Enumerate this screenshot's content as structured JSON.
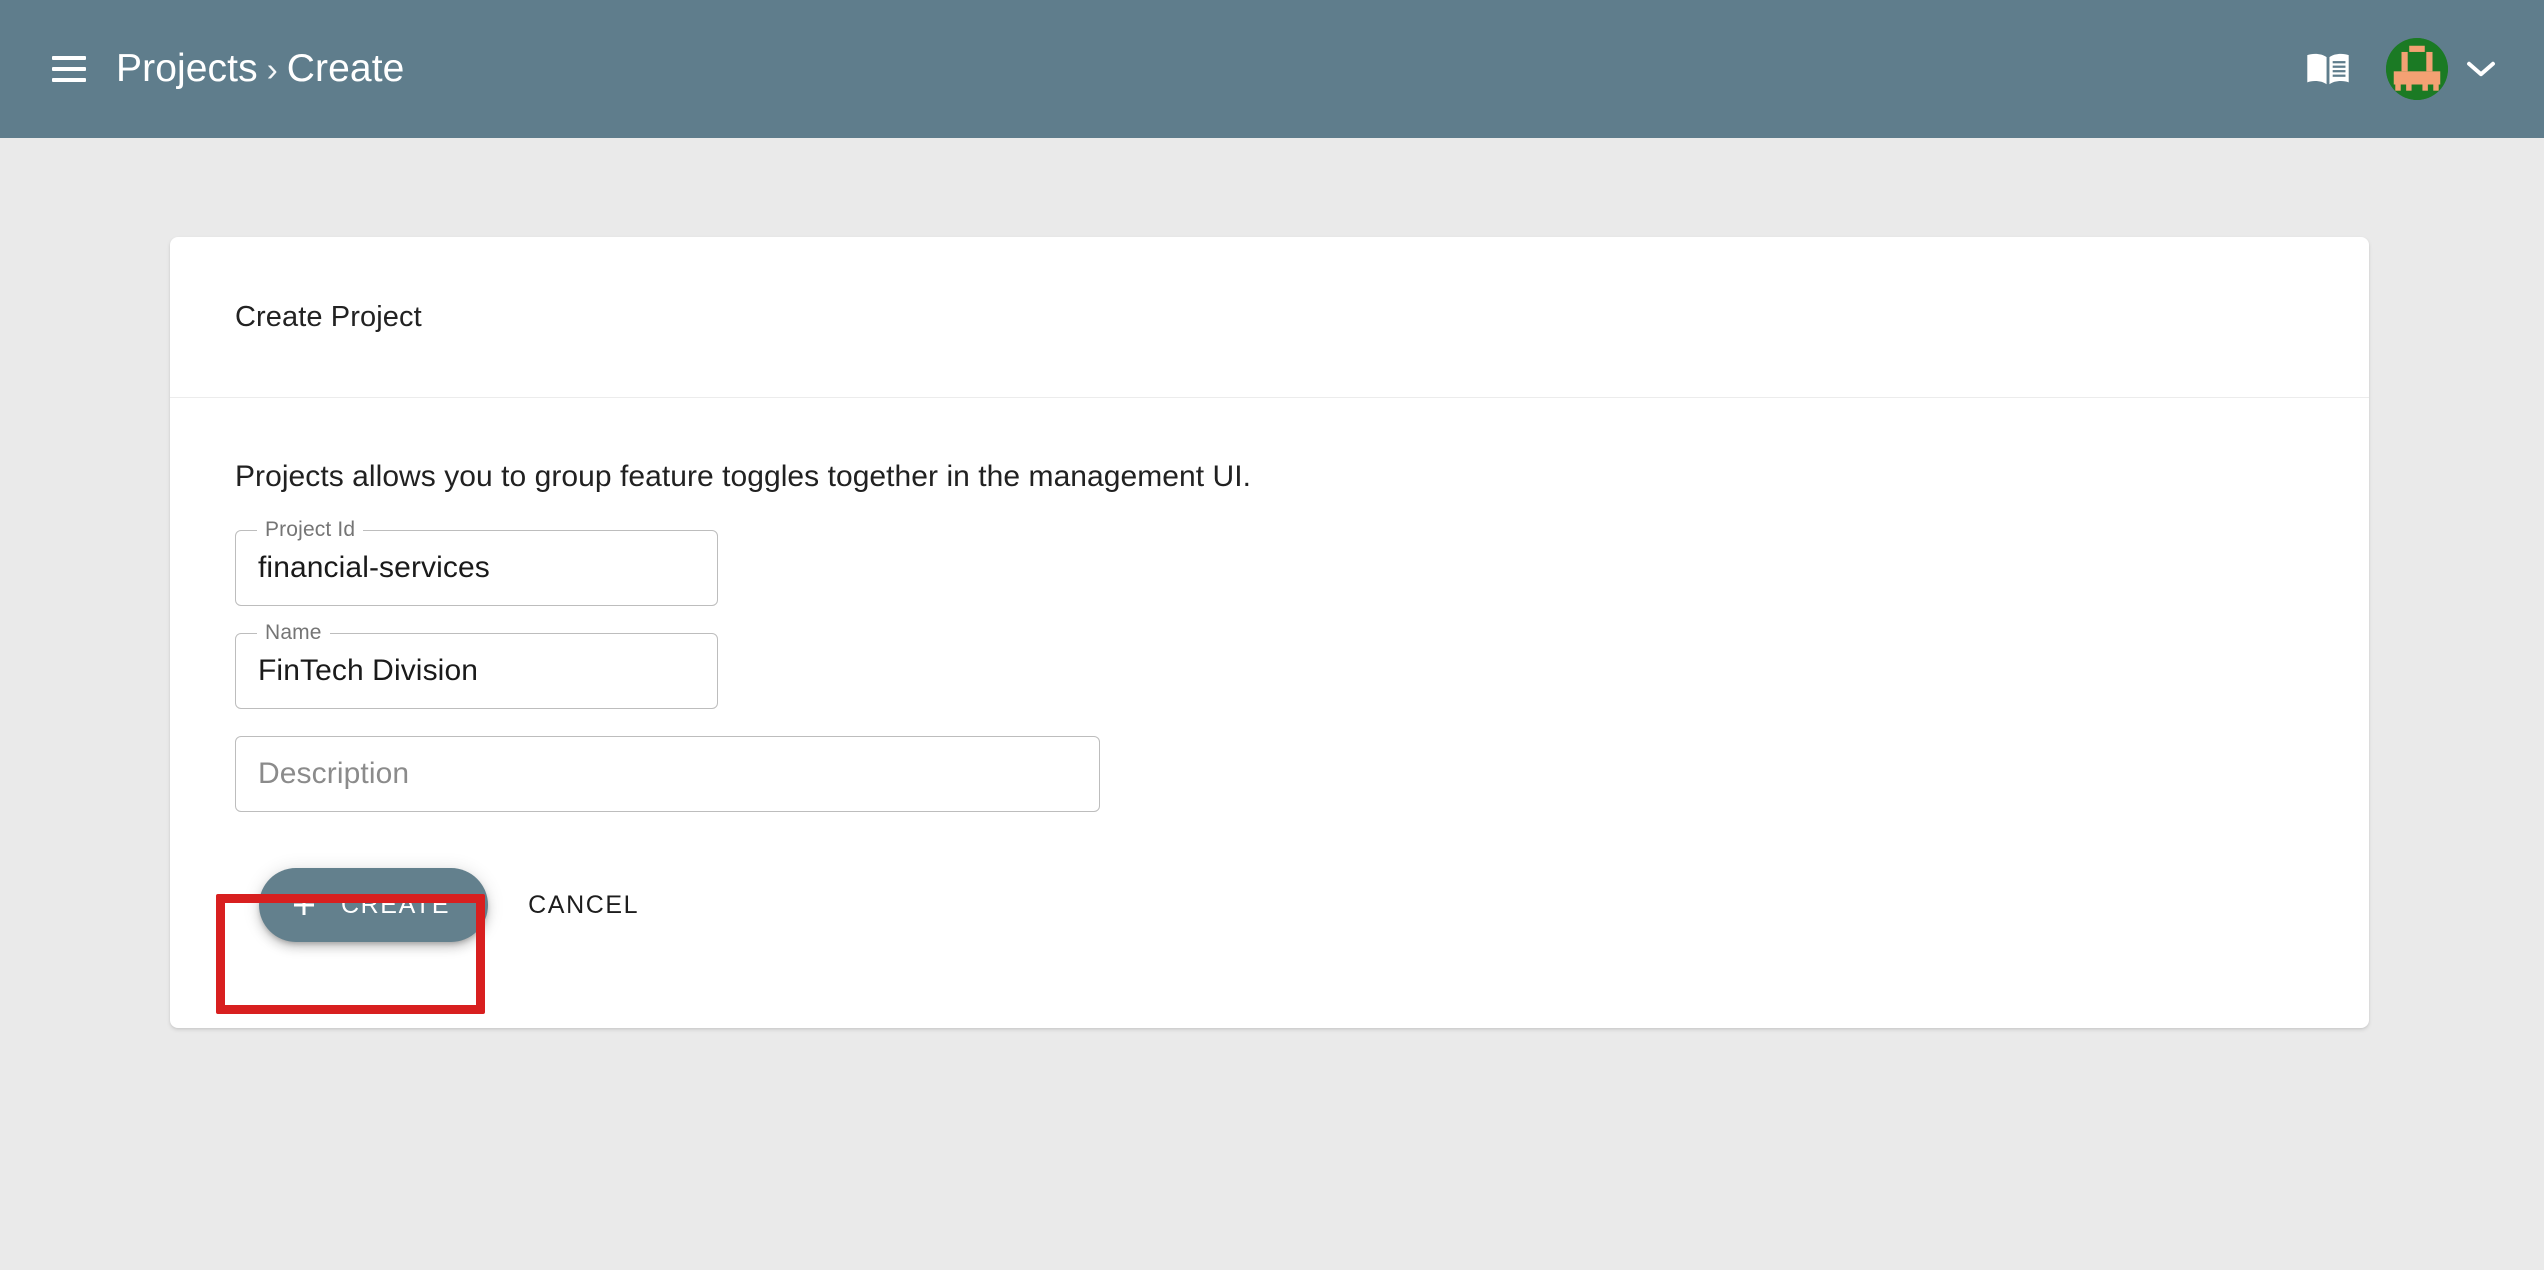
{
  "appbar": {
    "menu_icon": "hamburger-menu-icon",
    "breadcrumb": {
      "parent": "Projects",
      "separator": "›",
      "current": "Create"
    },
    "docs_icon": "book-icon",
    "avatar_icon": "user-avatar-identicon",
    "account_chevron_icon": "chevron-down-icon",
    "background_color": "#5f7d8c",
    "text_color": "#ffffff"
  },
  "card": {
    "title": "Create Project",
    "intro": "Projects allows you to group feature toggles together in the management UI.",
    "fields": [
      {
        "name": "project-id",
        "label": "Project Id",
        "value": "financial-services",
        "placeholder": "Project Id",
        "has_notch_label": true
      },
      {
        "name": "project-name",
        "label": "Name",
        "value": "FinTech Division",
        "placeholder": "Name",
        "has_notch_label": true
      },
      {
        "name": "project-description",
        "label": "Description",
        "value": "",
        "placeholder": "Description",
        "has_notch_label": false
      }
    ],
    "actions": {
      "create_label": "CREATE",
      "create_icon": "plus-icon",
      "create_color": "#63808d",
      "cancel_label": "CANCEL"
    },
    "background_color": "#ffffff"
  },
  "annotation": {
    "name": "create-button-highlight",
    "color": "#d81f1f"
  },
  "page": {
    "background_color": "#eaeaea"
  }
}
